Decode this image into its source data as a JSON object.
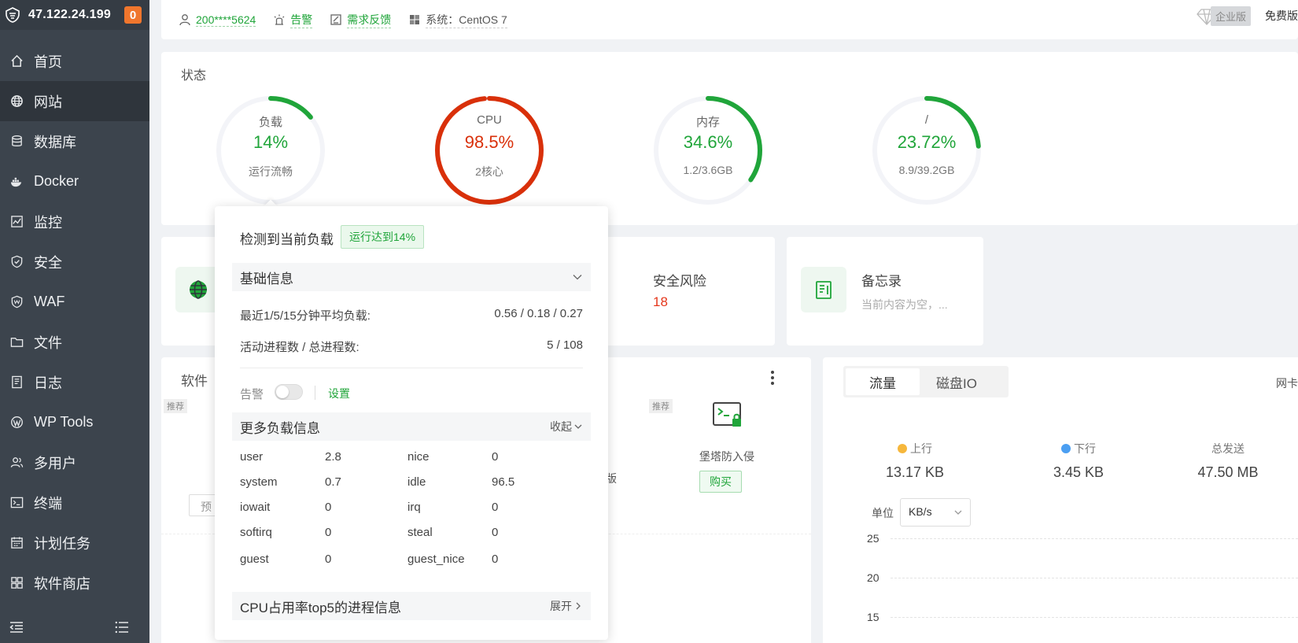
{
  "sidebar": {
    "ip": "47.122.24.199",
    "badge": "0",
    "items": [
      {
        "label": "首页",
        "icon": "home-icon"
      },
      {
        "label": "网站",
        "icon": "globe-icon"
      },
      {
        "label": "数据库",
        "icon": "database-icon"
      },
      {
        "label": "Docker",
        "icon": "docker-icon"
      },
      {
        "label": "监控",
        "icon": "monitor-icon"
      },
      {
        "label": "安全",
        "icon": "shield-icon"
      },
      {
        "label": "WAF",
        "icon": "waf-icon"
      },
      {
        "label": "文件",
        "icon": "folder-icon"
      },
      {
        "label": "日志",
        "icon": "log-icon"
      },
      {
        "label": "WP Tools",
        "icon": "wordpress-icon"
      },
      {
        "label": "多用户",
        "icon": "users-icon"
      },
      {
        "label": "终端",
        "icon": "terminal-icon"
      },
      {
        "label": "计划任务",
        "icon": "calendar-icon"
      },
      {
        "label": "软件商店",
        "icon": "apps-icon"
      }
    ]
  },
  "topbar": {
    "user": "200****5624",
    "alarm": "告警",
    "feedback": "需求反馈",
    "system": "系统：CentOS 7",
    "enterprise": "企业版",
    "free": "免费版"
  },
  "status": {
    "title": "状态",
    "gauges": [
      {
        "label": "负载",
        "value": "14%",
        "sub": "运行流畅",
        "percent": 14,
        "color": "#20a53a"
      },
      {
        "label": "CPU",
        "value": "98.5%",
        "sub": "2核心",
        "percent": 98.5,
        "color": "#d9300a"
      },
      {
        "label": "内存",
        "value": "34.6%",
        "sub": "1.2/3.6GB",
        "percent": 34.6,
        "color": "#20a53a"
      },
      {
        "label": "/",
        "value": "23.72%",
        "sub": "8.9/39.2GB",
        "percent": 23.72,
        "color": "#20a53a"
      }
    ]
  },
  "overview": {
    "security": {
      "title": "安全风险",
      "value": "18"
    },
    "memo": {
      "title": "备忘录",
      "desc": "当前内容为空，..."
    }
  },
  "software": {
    "title": "软件",
    "recommend": "推荐",
    "preview": "预",
    "partial_name": "构版",
    "item_name": "堡塔防入侵",
    "buy": "购买"
  },
  "traffic": {
    "tabs": [
      "流量",
      "磁盘IO"
    ],
    "net": "网卡",
    "up_label": "上行",
    "up_value": "13.17 KB",
    "down_label": "下行",
    "down_value": "3.45 KB",
    "total_label": "总发送",
    "total_value": "47.50 MB",
    "unit_label": "单位",
    "unit_value": "KB/s",
    "y_ticks": [
      "25",
      "20",
      "15"
    ],
    "up_color": "#f6b73c",
    "down_color": "#4b9ff2"
  },
  "popover": {
    "title": "检测到当前负载",
    "tag": "运行达到14%",
    "basic_section": "基础信息",
    "avg_label": "最近1/5/15分钟平均负载:",
    "avg_value": "0.56 / 0.18 / 0.27",
    "proc_label": "活动进程数 / 总进程数:",
    "proc_value": "5 / 108",
    "alarm_label": "告警",
    "settings": "设置",
    "more_section": "更多负载信息",
    "collapse": "收起",
    "cpu_kv": [
      {
        "k1": "user",
        "v1": "2.8",
        "k2": "nice",
        "v2": "0"
      },
      {
        "k1": "system",
        "v1": "0.7",
        "k2": "idle",
        "v2": "96.5"
      },
      {
        "k1": "iowait",
        "v1": "0",
        "k2": "irq",
        "v2": "0"
      },
      {
        "k1": "softirq",
        "v1": "0",
        "k2": "steal",
        "v2": "0"
      },
      {
        "k1": "guest",
        "v1": "0",
        "k2": "guest_nice",
        "v2": "0"
      }
    ],
    "top5_section": "CPU占用率top5的进程信息",
    "expand": "展开"
  }
}
